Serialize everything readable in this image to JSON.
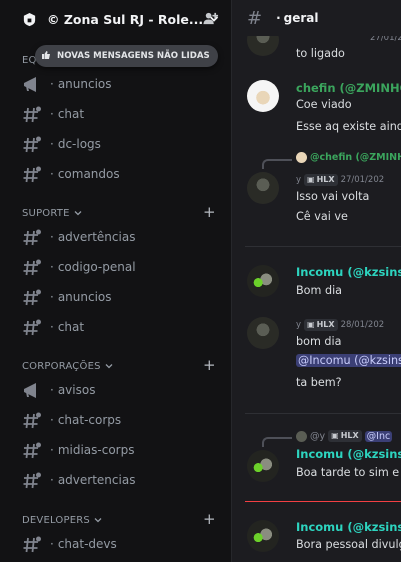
{
  "server": {
    "name": "© Zona Sul RJ - Role..."
  },
  "new_messages_badge": "NOVAS MENSAGENS NÃO LIDAS",
  "categories": [
    {
      "name": "EQ",
      "channels": [
        "anuncios",
        "chat",
        "dc-logs",
        "comandos"
      ]
    },
    {
      "name": "SUPORTE",
      "channels": [
        "advertências",
        "codigo-penal",
        "anuncios",
        "chat"
      ]
    },
    {
      "name": "CORPORAÇÕES",
      "channels": [
        "avisos",
        "chat-corps",
        "midias-corps",
        "advertencias"
      ]
    },
    {
      "name": "DEVELOPERS",
      "channels": [
        "chat-devs"
      ]
    }
  ],
  "channel": {
    "name": "geral"
  },
  "messages": {
    "m0": {
      "meta_time": "27/01/202",
      "line": "to ligado"
    },
    "m1": {
      "author": "chefin (@ZMINHOC",
      "lines": [
        "Coe viado",
        "Esse aq existe ainda"
      ]
    },
    "m2": {
      "reply_to": "@chefin (@ZMINHO",
      "meta_prefix": "y",
      "tag": "HLX",
      "time": "27/01/202",
      "lines": [
        "Isso vai volta",
        "Cê vai ve"
      ]
    },
    "m3": {
      "author": "Incomu (@kzsinsk)",
      "line": "Bom dia"
    },
    "m4": {
      "meta_prefix": "y",
      "tag": "HLX",
      "time": "28/01/202",
      "line": "bom dia",
      "mention": "@Incomu (@kzsins",
      "line2": "ta bem?"
    },
    "m5": {
      "reply_prefix": "@y",
      "reply_tag": "HLX",
      "reply_mention": "@Inc",
      "author": "Incomu (@kzsinsk)",
      "line": "Boa tarde to sim e t"
    },
    "m6": {
      "author": "Incomu (@kzsinsk)",
      "line": "Bora pessoal divulga"
    }
  },
  "colors": {
    "chefin": "#3ba55d",
    "incomu": "#2dd4bf",
    "mention_bg": "#3b3f75",
    "unread_line": "#f23f43"
  }
}
